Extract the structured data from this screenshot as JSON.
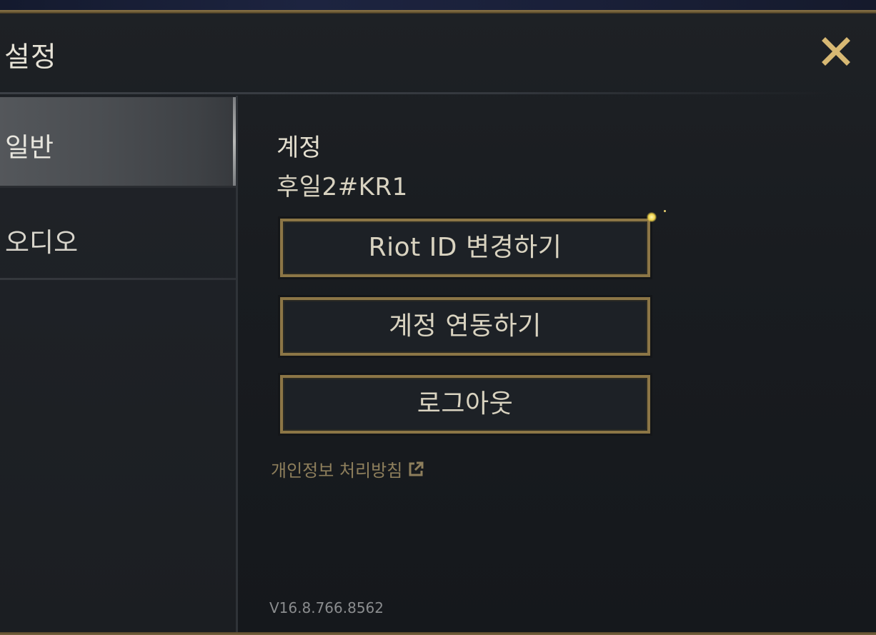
{
  "header": {
    "title": "설정"
  },
  "sidebar": {
    "items": [
      {
        "label": "일반",
        "active": true
      },
      {
        "label": "오디오",
        "active": false
      }
    ]
  },
  "account": {
    "heading": "계정",
    "riot_id": "후일2#KR1",
    "buttons": {
      "change_id": "Riot ID 변경하기",
      "link_account": "계정 연동하기",
      "logout": "로그아웃"
    },
    "privacy_link": "개인정보 처리방침"
  },
  "version": "V16.8.766.8562",
  "colors": {
    "accent_gold": "#8c7646",
    "close_gold": "#d7b873",
    "link_gold": "#8e7f5c"
  },
  "icons": {
    "close": "close-icon",
    "external": "external-link-icon"
  }
}
